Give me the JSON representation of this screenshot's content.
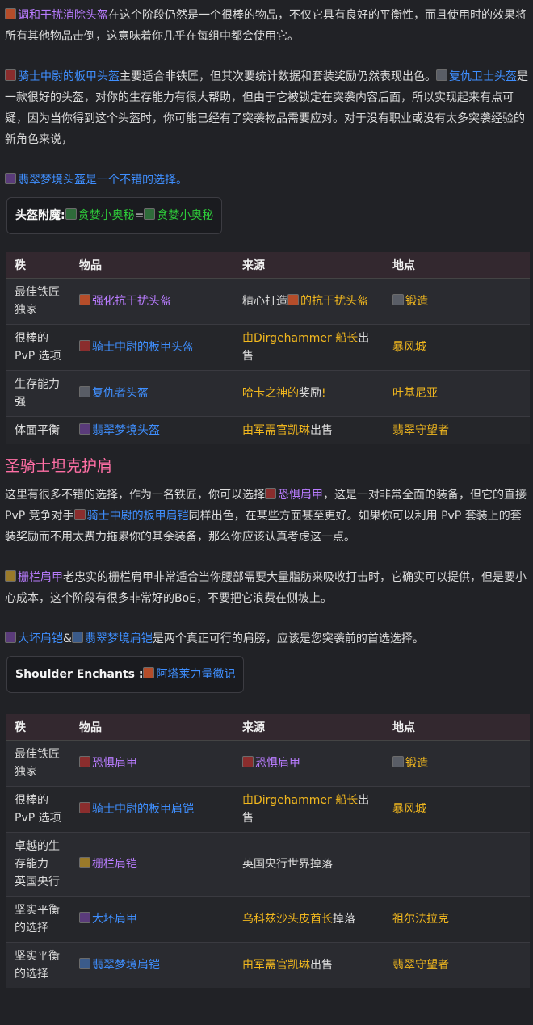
{
  "para1": {
    "item": "调和干扰消除头盔",
    "text": "在这个阶段仍然是一个很棒的物品，不仅它具有良好的平衡性，而且使用时的效果将所有其他物品击倒，这意味着你几乎在每组中都会使用它。"
  },
  "para2": {
    "item1": "骑士中尉的板甲头盔",
    "text1": "主要适合非铁匠，但其次要统计数据和套装奖励仍然表现出色。",
    "item2": "复仇卫士头盔",
    "text2": "是一款很好的头盔，对你的生存能力有很大帮助，但由于它被锁定在突袭内容后面，所以实现起来有点可疑，因为当你得到这个头盔时，你可能已经有了突袭物品需要应对。对于没有职业或没有太多突袭经验的新角色来说，"
  },
  "para3": {
    "item": "翡翠梦境头盔",
    "text": "是一个不错的选择。"
  },
  "helm_enchant": {
    "label": "头盔附魔:",
    "item1": "贪婪小奥秘",
    "eq": "=",
    "item2": "贪婪小奥秘"
  },
  "table1": {
    "headers": [
      "秩",
      "物品",
      "来源",
      "地点"
    ],
    "rows": [
      {
        "rank": "最佳铁匠独家",
        "item": "强化抗干扰头盔",
        "source_pre": "精心打造",
        "source_item": "的抗干扰头盔",
        "source_post": "",
        "location": "锻造"
      },
      {
        "rank": "很棒的 PvP 选项",
        "item": "骑士中尉的板甲头盔",
        "source_pre": "",
        "source_item": "由Dirgehammer 船长",
        "source_post": "出售",
        "location": "暴风城"
      },
      {
        "rank": "生存能力强",
        "item": "复仇者头盔",
        "source_pre": "",
        "source_item": "哈卡之神的",
        "source_post": "奖励",
        "source_mark": "!",
        "location": "叶基尼亚"
      },
      {
        "rank": "体面平衡",
        "item": "翡翠梦境头盔",
        "source_pre": "",
        "source_item": "由军需官凯琳",
        "source_post": "出售",
        "location": "翡翠守望者"
      }
    ]
  },
  "section_title": "圣骑士坦克护肩",
  "para4": {
    "text1": "这里有很多不错的选择，作为一名铁匠，你可以选择",
    "item1": "恐惧肩甲",
    "text2": "，这是一对非常全面的装备，但它的直接 PvP 竞争对手",
    "item2": "骑士中尉的板甲肩铠",
    "text3": "同样出色，在某些方面甚至更好。如果你可以利用 PvP 套装上的套装奖励而不用太费力拖累你的其余装备，那么你应该认真考虑这一点。"
  },
  "para5": {
    "item": "栅栏肩甲",
    "text": "老忠实的栅栏肩甲非常适合当你腰部需要大量脂肪来吸收打击时，它确实可以提供，但是要小心成本，这个阶段有很多非常好的BoE，不要把它浪费在侧坡上。"
  },
  "para6": {
    "item1": "大坏肩铠",
    "amp": "&",
    "item2": "翡翠梦境肩铠",
    "text": "是两个真正可行的肩膀，应该是您突袭前的首选选择。"
  },
  "shoulder_enchant": {
    "label": "Shoulder Enchants :",
    "item": "阿塔莱力量徽记"
  },
  "table2": {
    "headers": [
      "秩",
      "物品",
      "来源",
      "地点"
    ],
    "rows": [
      {
        "rank": "最佳铁匠独家",
        "item": "恐惧肩甲",
        "source_item": "恐惧肩甲",
        "source_post": "",
        "location": "锻造"
      },
      {
        "rank": "很棒的 PvP 选项",
        "item": "骑士中尉的板甲肩铠",
        "source_item": "由Dirgehammer 船长",
        "source_post": "出售",
        "location": "暴风城"
      },
      {
        "rank": "卓越的生存能力 英国央行",
        "item": "栅栏肩铠",
        "source_plain": "英国央行世界掉落",
        "location": ""
      },
      {
        "rank": "坚实平衡的选择",
        "item": "大坏肩甲",
        "source_item": "乌科兹沙头皮酋长",
        "source_post": "掉落",
        "location": "祖尔法拉克"
      },
      {
        "rank": "坚实平衡的选择",
        "item": "翡翠梦境肩铠",
        "source_item": "由军需官凯琳",
        "source_post": "出售",
        "location": "翡翠守望者"
      }
    ]
  }
}
